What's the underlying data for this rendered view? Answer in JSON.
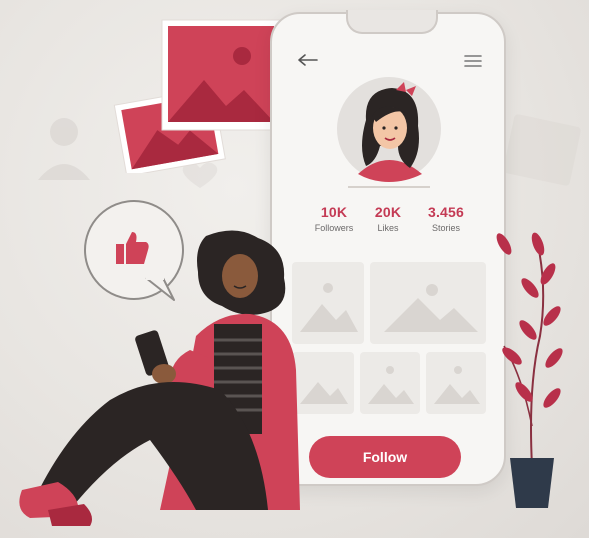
{
  "profile": {
    "stats": [
      {
        "value": "10K",
        "label": "Followers"
      },
      {
        "value": "20K",
        "label": "Likes"
      },
      {
        "value": "3.456",
        "label": "Stories"
      }
    ],
    "follow_label": "Follow"
  },
  "icons": {
    "back": "arrow-left-icon",
    "menu": "hamburger-menu-icon",
    "like": "thumbs-up-icon"
  },
  "colors": {
    "accent": "#cf4358",
    "accent_dark": "#c43a54",
    "phone_bg": "#f7f6f4"
  }
}
